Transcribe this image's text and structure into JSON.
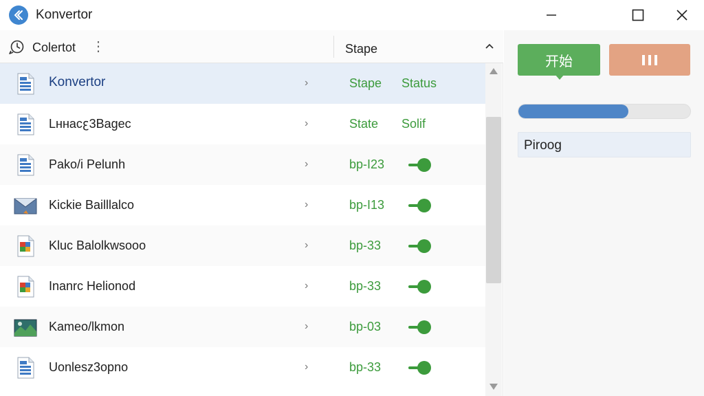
{
  "window": {
    "title": "Konvertor",
    "controls": {
      "minimize_icon": "minimize-icon",
      "maximize_icon": "maximize-icon",
      "close_icon": "close-icon"
    }
  },
  "toolbar": {
    "label": "Colertot",
    "more_icon": "more-vertical-icon",
    "column_label": "Stape"
  },
  "list": {
    "rows": [
      {
        "name": "Konvertor",
        "stage": "Stape",
        "status": "Status",
        "icon": "document-icon",
        "selected": true
      },
      {
        "name": "Lннacꜫ3Bagec",
        "stage": "State",
        "status": "Solif",
        "icon": "document-icon"
      },
      {
        "name": "Pako/i Pelunh",
        "stage": "bp-I23",
        "status_toggle": true,
        "icon": "document-icon"
      },
      {
        "name": "Kickie Bailllalco",
        "stage": "bp-I13",
        "status_toggle": true,
        "icon": "image-icon"
      },
      {
        "name": "Kluc Balolkwsooo",
        "stage": "bp-33",
        "status_toggle": true,
        "icon": "colored-document-icon"
      },
      {
        "name": "Inanrc Helionod",
        "stage": "bp-33",
        "status_toggle": true,
        "icon": "colored-document-icon"
      },
      {
        "name": "Kameo/lkmon",
        "stage": "bp-03",
        "status_toggle": true,
        "icon": "landscape-image-icon"
      },
      {
        "name": "Uonlesz3opno",
        "stage": "bp-33",
        "status_toggle": true,
        "icon": "document-icon"
      }
    ]
  },
  "actions": {
    "start_label": "开始",
    "pause_icon": "pause-icon"
  },
  "progress": {
    "value_fraction": 0.64
  },
  "status_field": {
    "value": "Piroog"
  },
  "colors": {
    "accent_blue": "#4f86c7",
    "start_green": "#5cae5c",
    "pause_orange": "#e3a383",
    "status_green": "#3c9b3c"
  }
}
